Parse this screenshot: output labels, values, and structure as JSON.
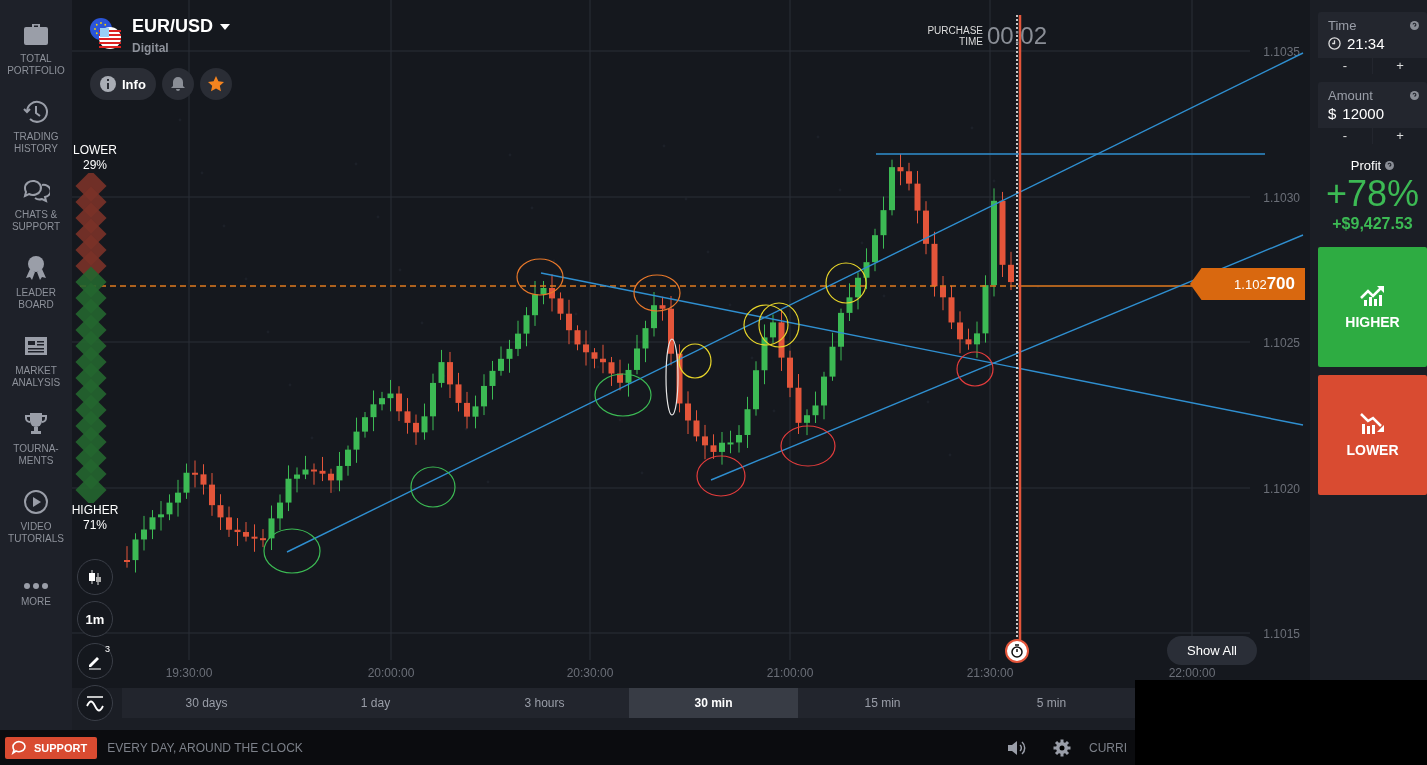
{
  "sidebar": {
    "items": [
      {
        "kind": "portfolio",
        "label": "TOTAL PORTFOLIO"
      },
      {
        "kind": "history",
        "label": "TRADING HISTORY"
      },
      {
        "kind": "chat",
        "label": "CHATS & SUPPORT"
      },
      {
        "kind": "medal",
        "label": "LEADER BOARD"
      },
      {
        "kind": "news",
        "label": "MARKET ANALYSIS"
      },
      {
        "kind": "trophy",
        "label": "TOURNA- MENTS"
      },
      {
        "kind": "video",
        "label": "VIDEO TUTORIALS"
      },
      {
        "kind": "more",
        "label": "MORE"
      }
    ]
  },
  "asset": {
    "name": "EUR/USD",
    "type": "Digital",
    "info_label": "Info",
    "favorite": true
  },
  "purchase_time": {
    "label": "PURCHASE TIME",
    "value": "00:02"
  },
  "sentiment": {
    "lower_label": "LOWER",
    "lower_value": "29%",
    "higher_label": "HIGHER",
    "higher_value": "71%",
    "level": 0.29
  },
  "chart": {
    "price_ticks": [
      "1.1035",
      "1.1030",
      "1.1025",
      "1.1020",
      "1.1015"
    ],
    "time_ticks": [
      "19:30:00",
      "20:00:00",
      "20:30:00",
      "21:00:00",
      "21:30:00",
      "22:00:00"
    ],
    "current_price": "1.102**700**"
  },
  "chart_tools": [
    {
      "kind": "candles"
    },
    {
      "kind": "interval",
      "label": "1m"
    },
    {
      "kind": "draw",
      "badge": "3"
    },
    {
      "kind": "indicators"
    }
  ],
  "show_all": "Show All",
  "timeframes": [
    {
      "label": "30 days",
      "selected": false
    },
    {
      "label": "1 day",
      "selected": false
    },
    {
      "label": "3 hours",
      "selected": false
    },
    {
      "label": "30 min",
      "selected": true
    },
    {
      "label": "15 min",
      "selected": false
    },
    {
      "label": "5 min",
      "selected": false
    }
  ],
  "trade": {
    "time": {
      "label": "Time",
      "value": "21:34"
    },
    "amount": {
      "label": "Amount",
      "currency": "$",
      "value": "12000"
    },
    "decrease": "-",
    "increase": "+",
    "profit": {
      "label": "Profit",
      "percent": "+78%",
      "amount": "+$9,427.53"
    },
    "higher": "HIGHER",
    "lower": "LOWER"
  },
  "bottom_bar": {
    "support": "SUPPORT",
    "tagline": "EVERY DAY, AROUND THE CLOCK",
    "currency": "CURRI"
  }
}
